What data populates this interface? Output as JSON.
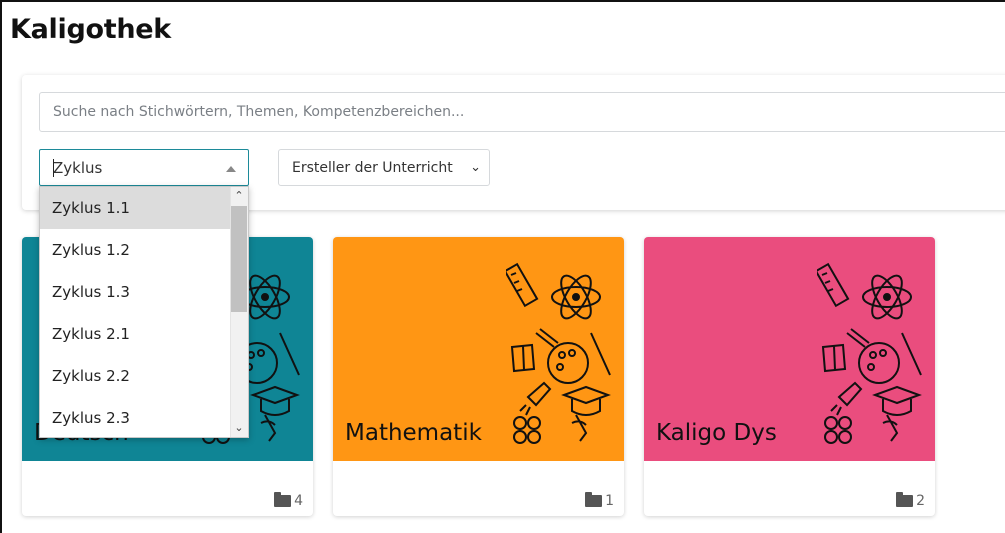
{
  "page": {
    "title": "Kaligothek"
  },
  "filters": {
    "search_placeholder": "Suche nach Stichwörtern, Themen, Kompetenzbereichen...",
    "zyklus": {
      "value": "Zyklus"
    },
    "ersteller": {
      "value": "Ersteller der Unterricht"
    }
  },
  "dropdown": {
    "options": [
      "Zyklus 1.1",
      "Zyklus 1.2",
      "Zyklus 1.3",
      "Zyklus 2.1",
      "Zyklus 2.2",
      "Zyklus 2.3"
    ],
    "highlighted_index": 0
  },
  "cards": [
    {
      "title": "Deutsch",
      "color": "#0f8595",
      "count": "4",
      "icon": "folder-icon"
    },
    {
      "title": "Mathematik",
      "color": "#ff9614",
      "count": "1",
      "icon": "folder-icon"
    },
    {
      "title": "Kaligo Dys",
      "color": "#ea4d7e",
      "count": "2",
      "icon": "folder-icon"
    }
  ]
}
